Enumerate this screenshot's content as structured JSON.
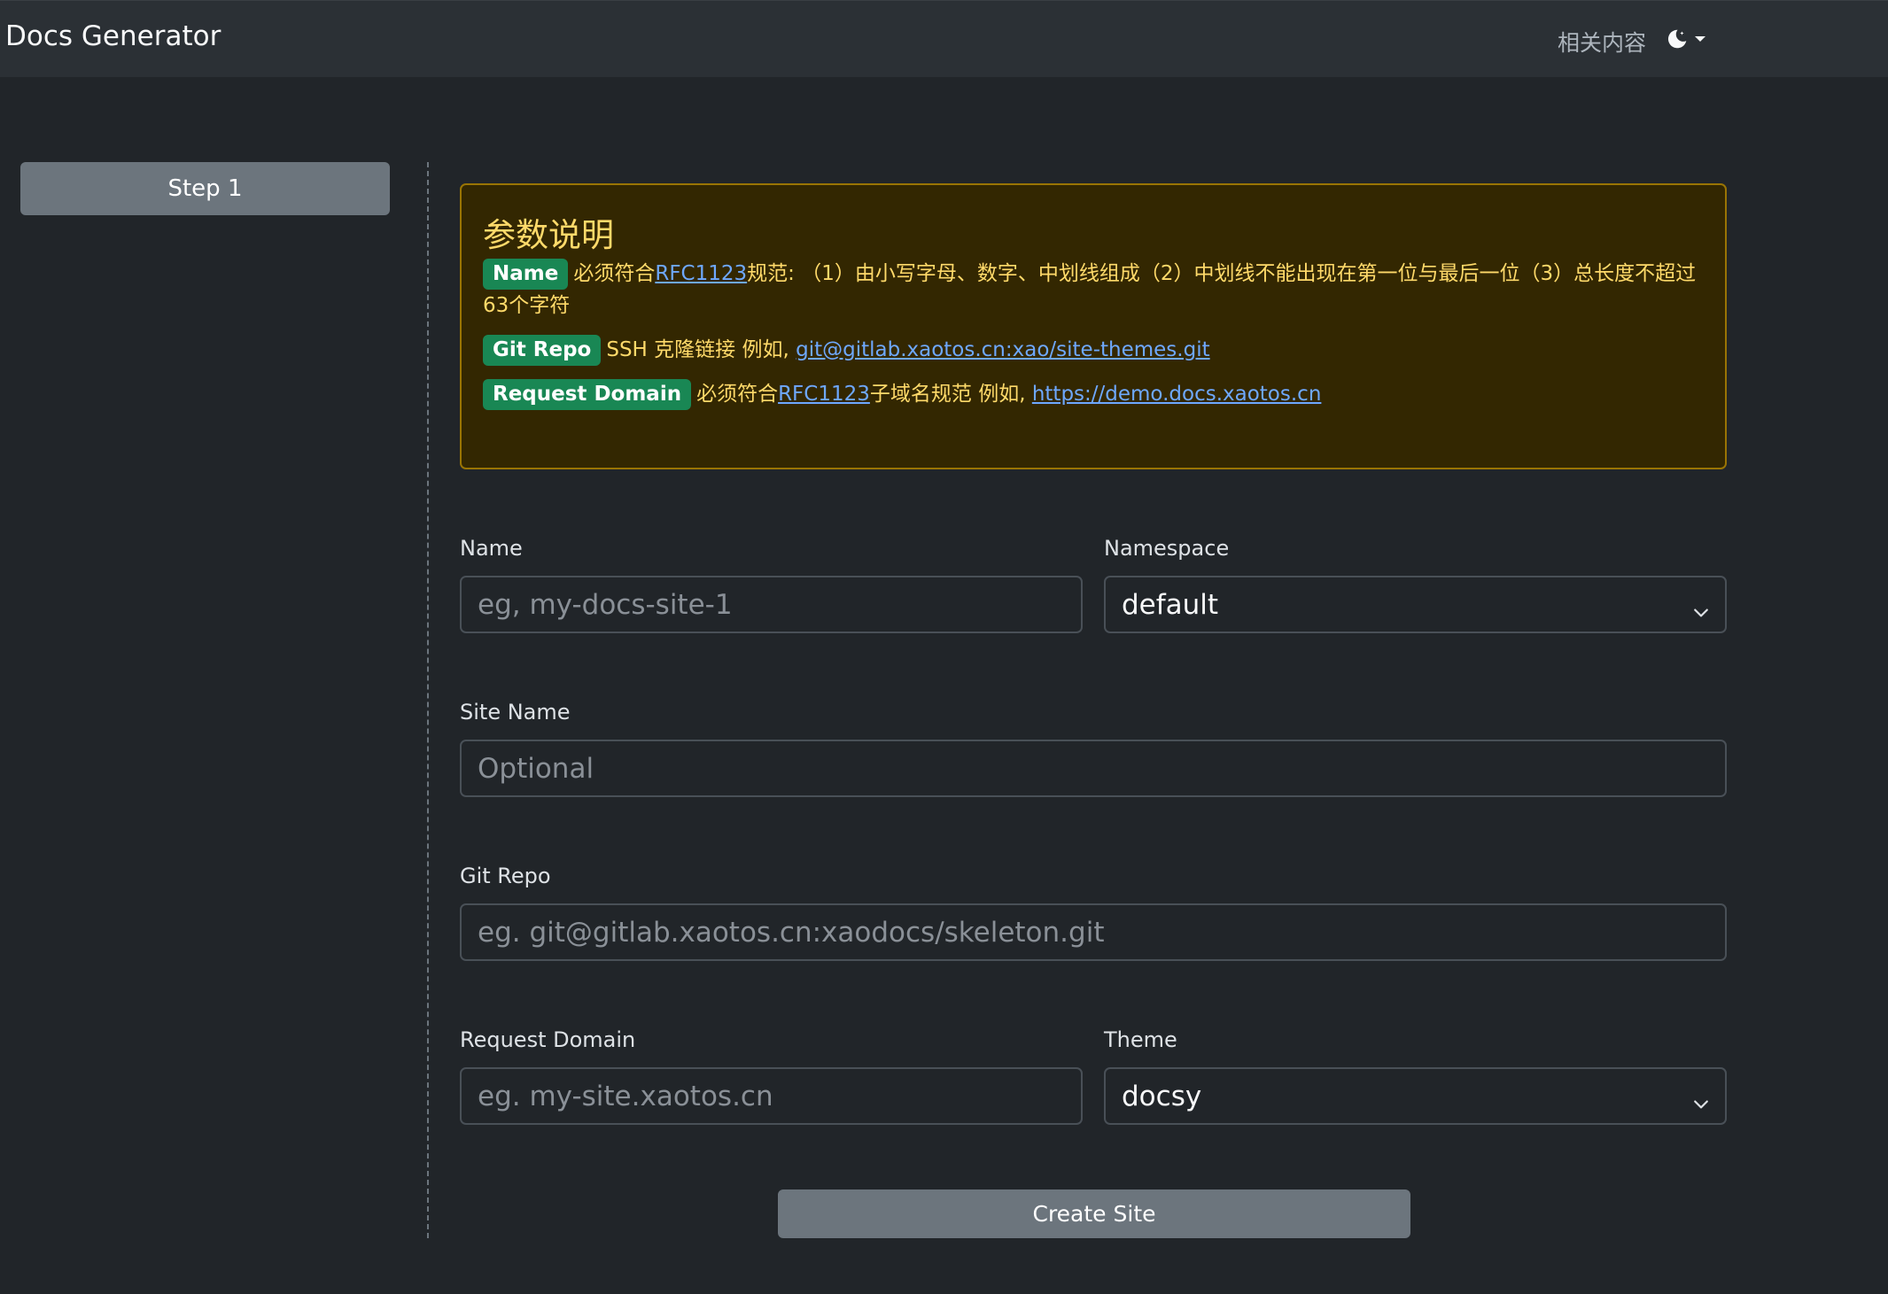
{
  "navbar": {
    "brand": "Docs Generator",
    "related_link": "相关内容",
    "theme_icon": "moon-icon"
  },
  "sidebar": {
    "step_label": "Step 1"
  },
  "alert": {
    "title": "参数说明",
    "name": {
      "badge": "Name",
      "text_before": "必须符合",
      "link": "RFC1123",
      "text_after": "规范: （1）由小写字母、数字、中划线组成（2）中划线不能出现在第一位与最后一位（3）总长度不超过63个字符"
    },
    "git_repo": {
      "badge": "Git Repo",
      "text_before": "SSH 克隆链接 例如, ",
      "link": "git@gitlab.xaotos.cn:xao/site-themes.git"
    },
    "request_domain": {
      "badge": "Request Domain",
      "text_before": "必须符合",
      "link1": "RFC1123",
      "text_mid": "子域名规范 例如, ",
      "link2": "https://demo.docs.xaotos.cn"
    }
  },
  "form": {
    "name": {
      "label": "Name",
      "placeholder": "eg, my-docs-site-1",
      "value": ""
    },
    "namespace": {
      "label": "Namespace",
      "selected": "default"
    },
    "site_name": {
      "label": "Site Name",
      "placeholder": "Optional",
      "value": ""
    },
    "git_repo": {
      "label": "Git Repo",
      "placeholder": "eg. git@gitlab.xaotos.cn:xaodocs/skeleton.git",
      "value": ""
    },
    "request_domain": {
      "label": "Request Domain",
      "placeholder": "eg. my-site.xaotos.cn",
      "value": ""
    },
    "theme": {
      "label": "Theme",
      "selected": "docsy"
    },
    "submit_label": "Create Site"
  },
  "colors": {
    "background": "#212529",
    "navbar": "#2b3035",
    "alert_bg": "#332701",
    "alert_border": "#997404",
    "alert_text": "#ffda6a",
    "badge_success": "#198754",
    "link": "#6ea8fe",
    "secondary_button": "#6c757d"
  }
}
